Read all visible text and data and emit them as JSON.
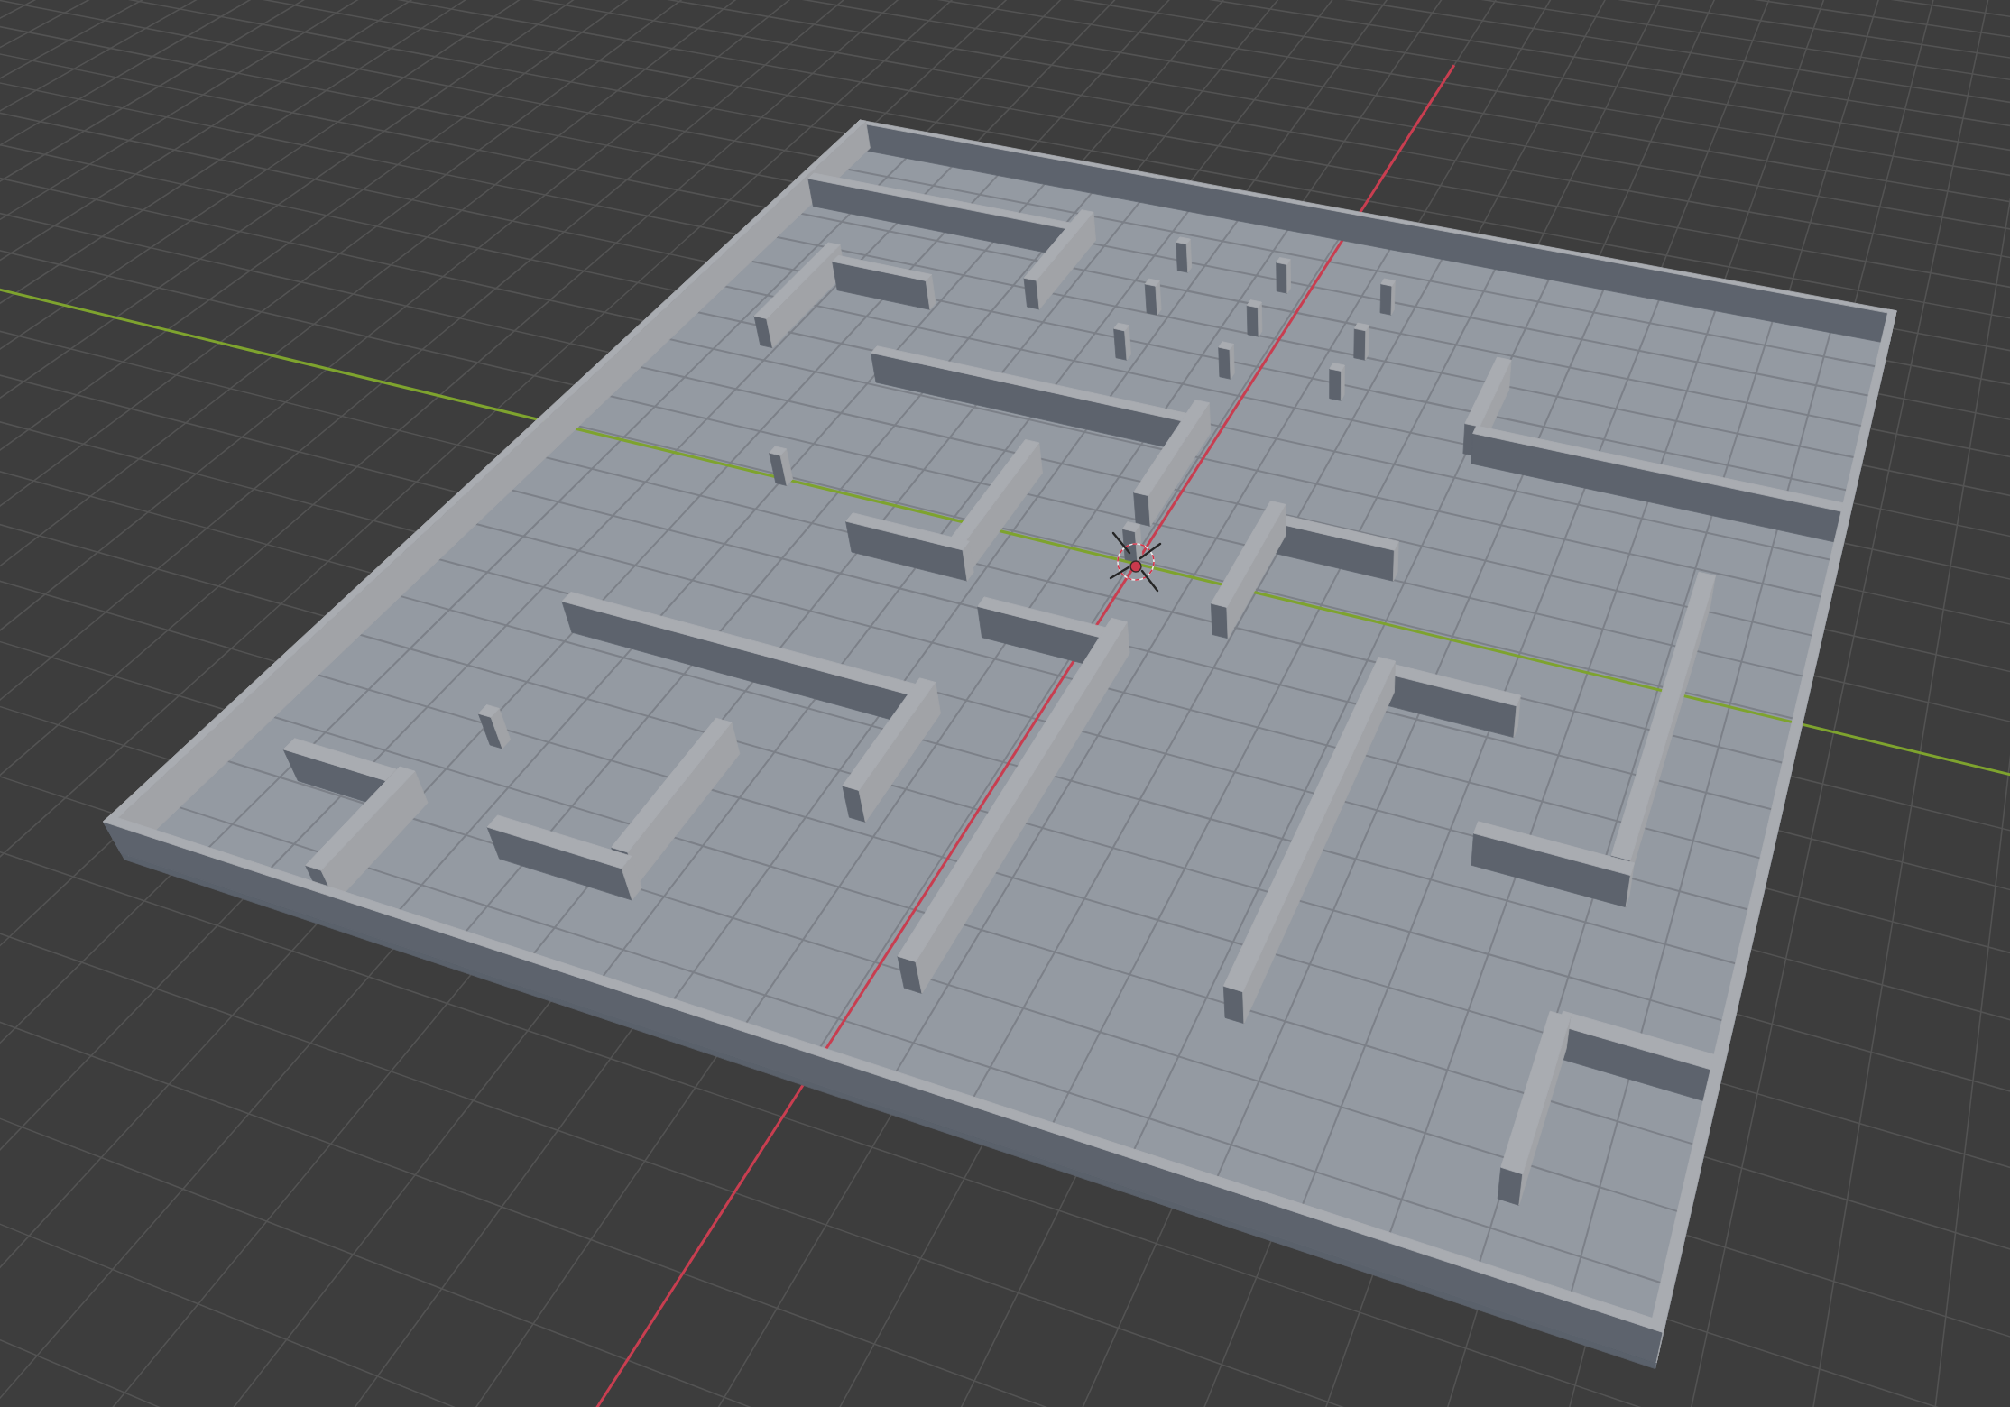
{
  "viewport": {
    "overlays": {
      "grid": true,
      "cursor": true
    },
    "axes": [
      {
        "kind": "x",
        "color": "#c83e50"
      },
      {
        "kind": "y",
        "color": "#7ea32e"
      }
    ],
    "model": {
      "kind": "maze"
    }
  }
}
